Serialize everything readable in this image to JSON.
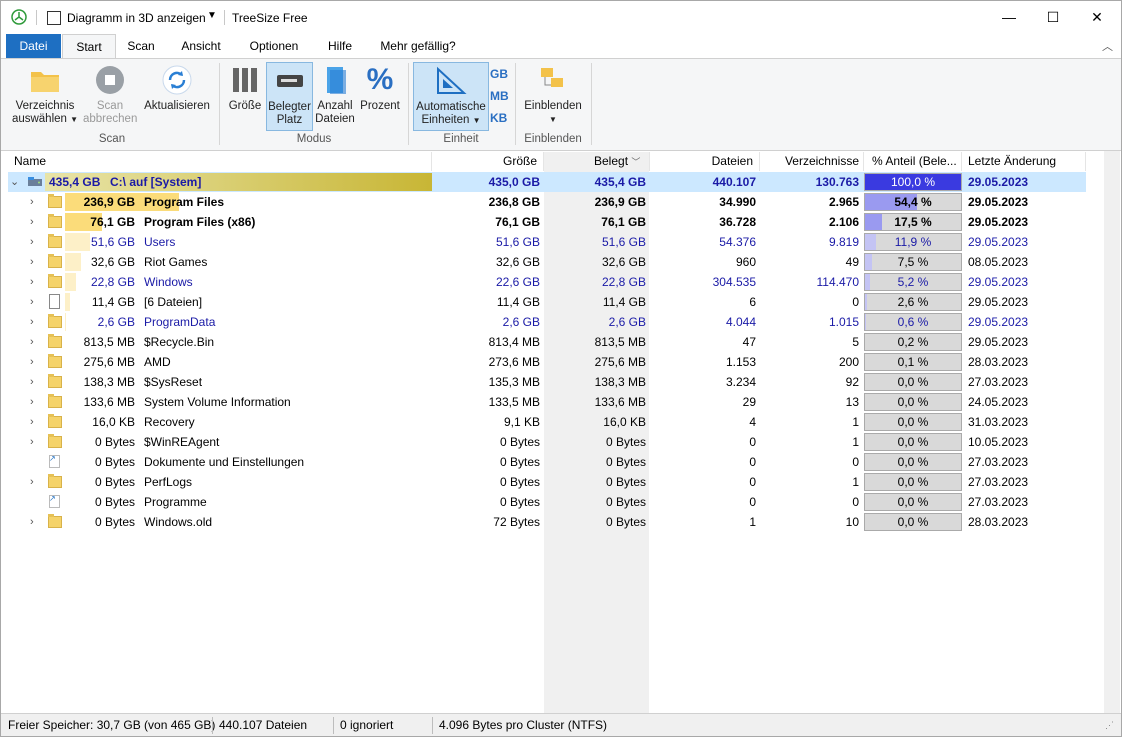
{
  "titlebar": {
    "quick_access_label": "Diagramm in 3D anzeigen",
    "title": "TreeSize Free",
    "min_glyph": "—",
    "max_glyph": "☐",
    "close_glyph": "✕"
  },
  "tabs": [
    "Datei",
    "Start",
    "Scan",
    "Ansicht",
    "Optionen",
    "Hilfe",
    "Mehr gefällig?"
  ],
  "ribbon": {
    "select_dir": [
      "Verzeichnis",
      "auswählen"
    ],
    "scan_abort": [
      "Scan",
      "abbrechen"
    ],
    "refresh": "Aktualisieren",
    "group_scan": "Scan",
    "size": "Größe",
    "allocated": [
      "Belegter",
      "Platz"
    ],
    "file_count": [
      "Anzahl",
      "Dateien"
    ],
    "percent": "Prozent",
    "group_mode": "Modus",
    "auto_units": [
      "Automatische",
      "Einheiten"
    ],
    "unit_gb": "GB",
    "unit_mb": "MB",
    "unit_kb": "KB",
    "group_unit": "Einheit",
    "show": "Einblenden",
    "group_show": "Einblenden"
  },
  "columns": {
    "name": "Name",
    "size": "Größe",
    "allocated": "Belegt",
    "files": "Dateien",
    "dirs": "Verzeichnisse",
    "percent": "% Anteil (Bele...",
    "modified": "Letzte Änderung"
  },
  "root": {
    "size_label": "435,4 GB",
    "name": "C:\\  auf  [System]",
    "size": "435,0 GB",
    "allocated": "435,4 GB",
    "files": "440.107",
    "dirs": "130.763",
    "percent": 100.0,
    "percent_text": "100,0 %",
    "modified": "29.05.2023"
  },
  "rows": [
    {
      "size_label": "236,9 GB",
      "name": "Program Files",
      "size": "236,8 GB",
      "allocated": "236,9 GB",
      "files": "34.990",
      "dirs": "2.965",
      "percent": 54.4,
      "percent_text": "54,4 %",
      "modified": "29.05.2023",
      "style": "bold",
      "icon": "folder"
    },
    {
      "size_label": "76,1 GB",
      "name": "Program Files (x86)",
      "size": "76,1 GB",
      "allocated": "76,1 GB",
      "files": "36.728",
      "dirs": "2.106",
      "percent": 17.5,
      "percent_text": "17,5 %",
      "modified": "29.05.2023",
      "style": "bold",
      "icon": "folder"
    },
    {
      "size_label": "51,6 GB",
      "name": "Users",
      "size": "51,6 GB",
      "allocated": "51,6 GB",
      "files": "54.376",
      "dirs": "9.819",
      "percent": 11.9,
      "percent_text": "11,9 %",
      "modified": "29.05.2023",
      "style": "blue",
      "icon": "folder"
    },
    {
      "size_label": "32,6 GB",
      "name": "Riot Games",
      "size": "32,6 GB",
      "allocated": "32,6 GB",
      "files": "960",
      "dirs": "49",
      "percent": 7.5,
      "percent_text": "7,5 %",
      "modified": "08.05.2023",
      "style": "normal",
      "icon": "folder"
    },
    {
      "size_label": "22,8 GB",
      "name": "Windows",
      "size": "22,6 GB",
      "allocated": "22,8 GB",
      "files": "304.535",
      "dirs": "114.470",
      "percent": 5.2,
      "percent_text": "5,2 %",
      "modified": "29.05.2023",
      "style": "blue",
      "icon": "folder"
    },
    {
      "size_label": "11,4 GB",
      "name": "[6 Dateien]",
      "size": "11,4 GB",
      "allocated": "11,4 GB",
      "files": "6",
      "dirs": "0",
      "percent": 2.6,
      "percent_text": "2,6 %",
      "modified": "29.05.2023",
      "style": "normal",
      "icon": "file"
    },
    {
      "size_label": "2,6 GB",
      "name": "ProgramData",
      "size": "2,6 GB",
      "allocated": "2,6 GB",
      "files": "4.044",
      "dirs": "1.015",
      "percent": 0.6,
      "percent_text": "0,6 %",
      "modified": "29.05.2023",
      "style": "blue",
      "icon": "folder"
    },
    {
      "size_label": "813,5 MB",
      "name": "$Recycle.Bin",
      "size": "813,4 MB",
      "allocated": "813,5 MB",
      "files": "47",
      "dirs": "5",
      "percent": 0.2,
      "percent_text": "0,2 %",
      "modified": "29.05.2023",
      "style": "normal",
      "icon": "folder"
    },
    {
      "size_label": "275,6 MB",
      "name": "AMD",
      "size": "273,6 MB",
      "allocated": "275,6 MB",
      "files": "1.153",
      "dirs": "200",
      "percent": 0.1,
      "percent_text": "0,1 %",
      "modified": "28.03.2023",
      "style": "normal",
      "icon": "folder"
    },
    {
      "size_label": "138,3 MB",
      "name": "$SysReset",
      "size": "135,3 MB",
      "allocated": "138,3 MB",
      "files": "3.234",
      "dirs": "92",
      "percent": 0.0,
      "percent_text": "0,0 %",
      "modified": "27.03.2023",
      "style": "normal",
      "icon": "folder"
    },
    {
      "size_label": "133,6 MB",
      "name": "System Volume Information",
      "size": "133,5 MB",
      "allocated": "133,6 MB",
      "files": "29",
      "dirs": "13",
      "percent": 0.0,
      "percent_text": "0,0 %",
      "modified": "24.05.2023",
      "style": "normal",
      "icon": "folder"
    },
    {
      "size_label": "16,0 KB",
      "name": "Recovery",
      "size": "9,1 KB",
      "allocated": "16,0 KB",
      "files": "4",
      "dirs": "1",
      "percent": 0.0,
      "percent_text": "0,0 %",
      "modified": "31.03.2023",
      "style": "normal",
      "icon": "folder"
    },
    {
      "size_label": "0 Bytes",
      "name": "$WinREAgent",
      "size": "0 Bytes",
      "allocated": "0 Bytes",
      "files": "0",
      "dirs": "1",
      "percent": 0.0,
      "percent_text": "0,0 %",
      "modified": "10.05.2023",
      "style": "normal",
      "icon": "folder"
    },
    {
      "size_label": "0 Bytes",
      "name": "Dokumente und Einstellungen",
      "size": "0 Bytes",
      "allocated": "0 Bytes",
      "files": "0",
      "dirs": "0",
      "percent": 0.0,
      "percent_text": "0,0 %",
      "modified": "27.03.2023",
      "style": "normal",
      "icon": "link"
    },
    {
      "size_label": "0 Bytes",
      "name": "PerfLogs",
      "size": "0 Bytes",
      "allocated": "0 Bytes",
      "files": "0",
      "dirs": "1",
      "percent": 0.0,
      "percent_text": "0,0 %",
      "modified": "27.03.2023",
      "style": "normal",
      "icon": "folder"
    },
    {
      "size_label": "0 Bytes",
      "name": "Programme",
      "size": "0 Bytes",
      "allocated": "0 Bytes",
      "files": "0",
      "dirs": "0",
      "percent": 0.0,
      "percent_text": "0,0 %",
      "modified": "27.03.2023",
      "style": "normal",
      "icon": "link"
    },
    {
      "size_label": "0 Bytes",
      "name": "Windows.old",
      "size": "72 Bytes",
      "allocated": "0 Bytes",
      "files": "1",
      "dirs": "10",
      "percent": 0.0,
      "percent_text": "0,0 %",
      "modified": "28.03.2023",
      "style": "normal",
      "icon": "folder"
    }
  ],
  "status": {
    "free": "Freier Speicher: 30,7 GB  (von 465 GB)",
    "files": "440.107 Dateien",
    "ignored": "0 ignoriert",
    "cluster": "4.096 Bytes pro Cluster (NTFS)"
  },
  "colors": {
    "accent": "#1e6fc2",
    "size_bar": "#f5d36a",
    "root_bar_start": "#e8e4a8",
    "root_bar_end": "#c8b635",
    "pct_fill": "#b8b8f0",
    "pct_fill_root": "#3a3ae0",
    "link_blue": "#1a1aa6"
  }
}
